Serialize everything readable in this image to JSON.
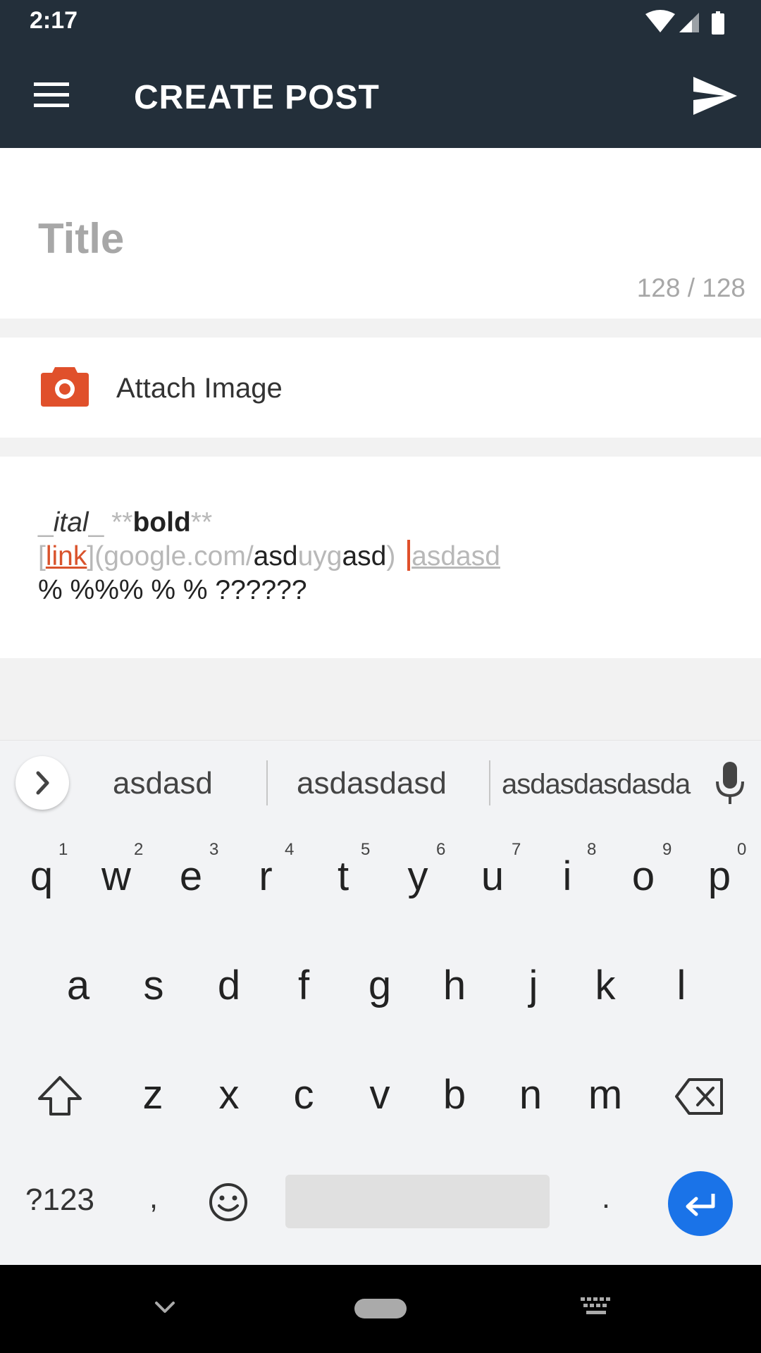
{
  "status": {
    "time": "2:17",
    "icons": [
      "wifi-icon",
      "signal-icon",
      "battery-icon"
    ]
  },
  "app_bar": {
    "title": "CREATE POST"
  },
  "title_field": {
    "placeholder": "Title",
    "value": "",
    "counter": "128 / 128"
  },
  "attach": {
    "label": "Attach Image"
  },
  "body": {
    "line1": {
      "a": "_",
      "b": "ital",
      "c": "_",
      "d": " **",
      "e": "bold",
      "f": "**"
    },
    "line2": {
      "a": "[",
      "b": "link",
      "c": "](google.com/",
      "d": "asd",
      "e": "uyg",
      "f": "asd",
      "g": ") ",
      "h": "asdasd"
    },
    "line3": "% %%% % % ??????"
  },
  "suggestions": [
    "asdasd",
    "asdasdasd",
    "asdasdasdasda"
  ],
  "keyboard": {
    "row1": [
      {
        "key": "q",
        "hint": "1"
      },
      {
        "key": "w",
        "hint": "2"
      },
      {
        "key": "e",
        "hint": "3"
      },
      {
        "key": "r",
        "hint": "4"
      },
      {
        "key": "t",
        "hint": "5"
      },
      {
        "key": "y",
        "hint": "6"
      },
      {
        "key": "u",
        "hint": "7"
      },
      {
        "key": "i",
        "hint": "8"
      },
      {
        "key": "o",
        "hint": "9"
      },
      {
        "key": "p",
        "hint": "0"
      }
    ],
    "row2": [
      "a",
      "s",
      "d",
      "f",
      "g",
      "h",
      "j",
      "k",
      "l"
    ],
    "row3": [
      "z",
      "x",
      "c",
      "v",
      "b",
      "n",
      "m"
    ],
    "symbols_label": "?123",
    "comma": ",",
    "period": "."
  },
  "colors": {
    "app_bar": "#232f3a",
    "accent": "#e0502b",
    "enter": "#1a73e8"
  }
}
